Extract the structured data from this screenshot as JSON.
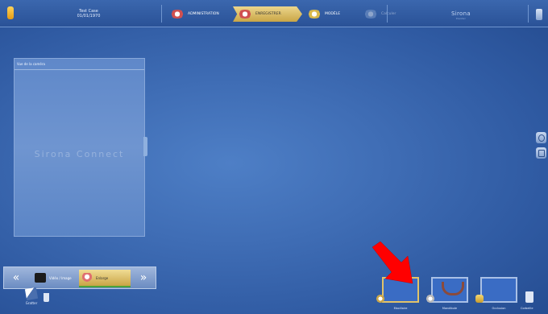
{
  "topbar": {
    "patient_name": "Test Case",
    "patient_date": "01/01/1970",
    "workflow": [
      {
        "label": "ADMINISTRATION",
        "state": "normal",
        "icon": "jaw-icon"
      },
      {
        "label": "ENREGISTRER",
        "state": "active",
        "icon": "jaw-icon"
      },
      {
        "label": "MODÈLE",
        "state": "normal",
        "icon": "tooth-model-icon"
      },
      {
        "label": "Calculer",
        "state": "disabled",
        "icon": "calculate-icon"
      }
    ],
    "brand": "Sirona",
    "brand_sub": "Dental"
  },
  "panel": {
    "title": "Vue de la caméra",
    "watermark": "Sirona Connect"
  },
  "phasebar": {
    "prev": "«",
    "next": "»",
    "phases": [
      {
        "label": "Vidéo / Image",
        "icon": "clapperboard-icon"
      },
      {
        "label": "Enlarge",
        "icon": "teeth-icon",
        "active": true
      }
    ]
  },
  "tools": {
    "brush_label": "Gratter"
  },
  "catalog": {
    "slots": [
      {
        "label": "Maxillaire",
        "selected": true
      },
      {
        "label": "Mandibule",
        "selected": false
      },
      {
        "label": "Occlusion",
        "selected": false
      }
    ],
    "basket_label": "Corbeille"
  },
  "colors": {
    "background": "#3f6db5",
    "accent_gold": "#e1c36a",
    "highlight_arrow": "#ff0000"
  }
}
